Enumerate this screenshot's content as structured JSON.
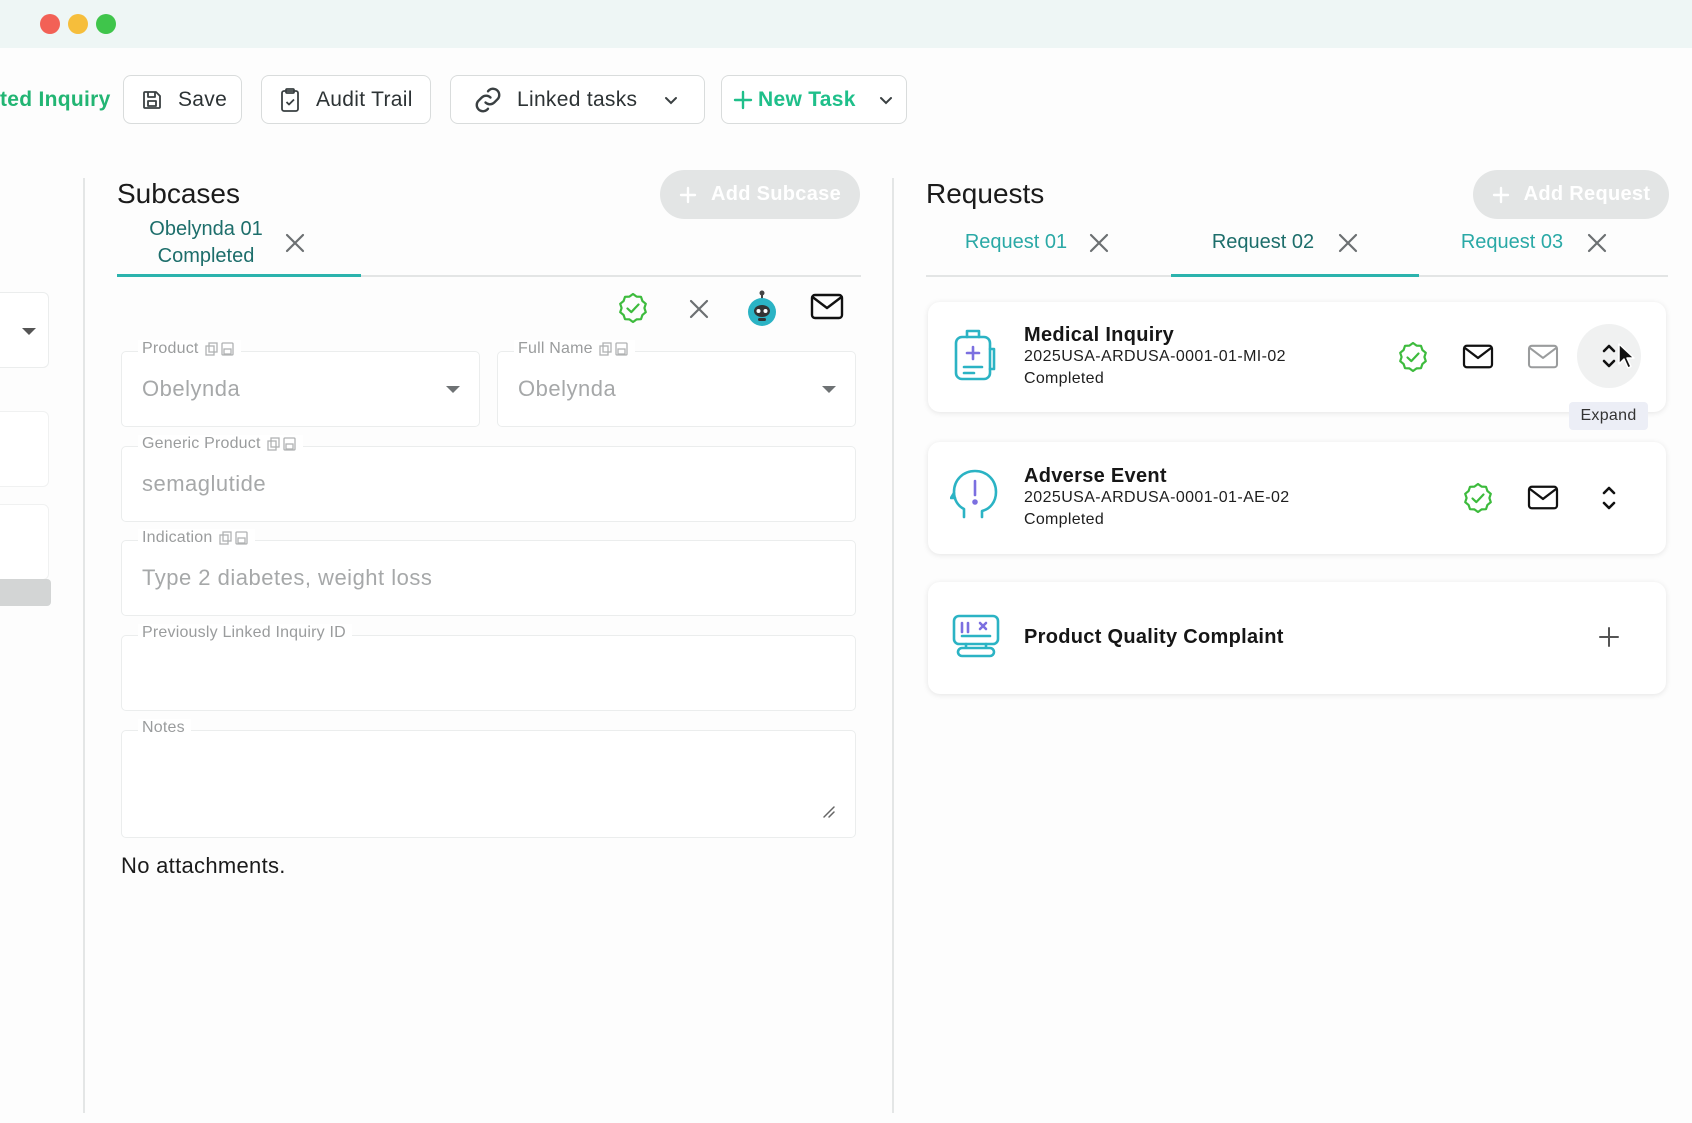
{
  "window": {
    "traffic_lights": [
      "#f26156",
      "#f6be3b",
      "#3fc54b"
    ]
  },
  "toolbar": {
    "inquiry_link_label": "ted Inquiry",
    "save_label": "Save",
    "audit_trail_label": "Audit Trail",
    "linked_tasks_label": "Linked tasks",
    "new_task_label": "New Task"
  },
  "subcases": {
    "title": "Subcases",
    "add_button_label": "Add Subcase",
    "tabs": [
      {
        "line1": "Obelynda 01",
        "line2": "Completed"
      }
    ],
    "fields": {
      "product": {
        "label": "Product",
        "value": "Obelynda"
      },
      "full_name": {
        "label": "Full Name",
        "value": "Obelynda"
      },
      "generic_product": {
        "label": "Generic Product",
        "value": "semaglutide"
      },
      "indication": {
        "label": "Indication",
        "value": "Type 2 diabetes, weight loss"
      },
      "previous_inquiry": {
        "label": "Previously Linked Inquiry ID",
        "value": ""
      },
      "notes": {
        "label": "Notes",
        "value": ""
      }
    },
    "attachments_text": "No attachments."
  },
  "requests": {
    "title": "Requests",
    "add_button_label": "Add Request",
    "tabs": [
      {
        "label": "Request 01"
      },
      {
        "label": "Request 02"
      },
      {
        "label": "Request 03"
      }
    ],
    "cards": [
      {
        "title": "Medical Inquiry",
        "id": "2025USA-ARDUSA-0001-01-MI-02",
        "status": "Completed"
      },
      {
        "title": "Adverse Event",
        "id": "2025USA-ARDUSA-0001-01-AE-02",
        "status": "Completed"
      },
      {
        "title": "Product Quality Complaint"
      }
    ],
    "expand_tooltip": "Expand"
  },
  "colors": {
    "accent": "#2bb3ad",
    "accent_dark": "#1d6e6b",
    "success": "#3dbb3d",
    "new_task": "#1fbf8a"
  },
  "icons": {
    "save": "save-icon",
    "audit": "clipboard-check-icon",
    "linked": "link-icon",
    "robot": "robot-icon",
    "mail": "mail-icon",
    "verified": "verified-badge-icon",
    "expand": "expand-chevrons-icon"
  }
}
